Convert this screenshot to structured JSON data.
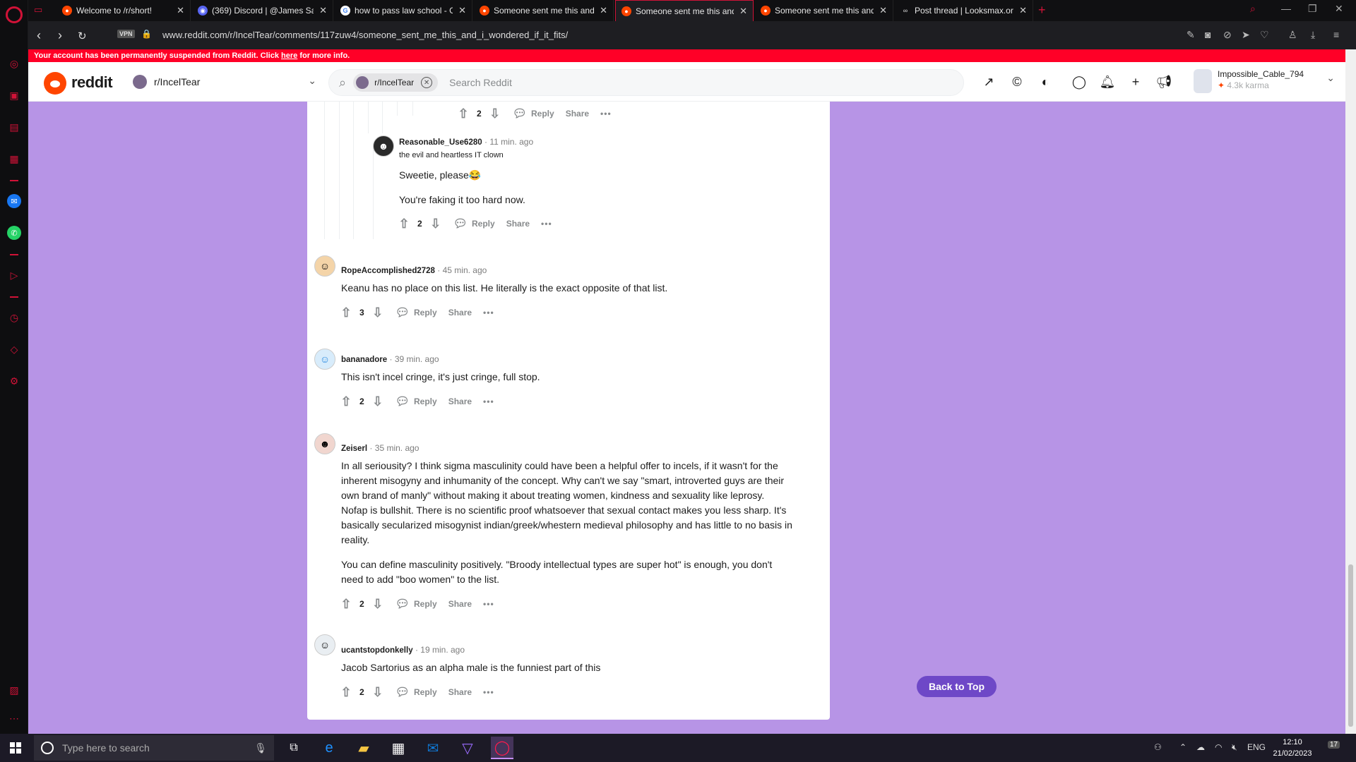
{
  "browser": {
    "tabs": [
      {
        "title": "Welcome to /r/short!",
        "icon": "reddit"
      },
      {
        "title": "(369) Discord | @James Sa",
        "icon": "discord",
        "badge": "369"
      },
      {
        "title": "how to pass law school - G",
        "icon": "google"
      },
      {
        "title": "Someone sent me this and",
        "icon": "reddit"
      },
      {
        "title": "Someone sent me this and",
        "icon": "reddit",
        "active": true
      },
      {
        "title": "Someone sent me this and",
        "icon": "reddit"
      },
      {
        "title": "Post thread | Looksmax.org",
        "icon": "looksmax"
      }
    ],
    "url": "www.reddit.com/r/IncelTear/comments/117zuw4/someone_sent_me_this_and_i_wondered_if_it_fits/",
    "vpn_label": "VPN"
  },
  "banner": {
    "text_before": "Your account has been permanently suspended from Reddit. Click ",
    "link": "here",
    "text_after": " for more info."
  },
  "header": {
    "logo_text": "reddit",
    "subreddit": "r/IncelTear",
    "search_chip": "r/IncelTear",
    "search_placeholder": "Search Reddit",
    "username": "Impossible_Cable_794",
    "karma": "4.3k karma"
  },
  "comments": [
    {
      "id": "top-partial",
      "score": "2",
      "reply": "Reply",
      "share": "Share"
    },
    {
      "id": "c1",
      "username": "Reasonable_Use6280",
      "time": "11 min. ago",
      "flair": "the evil and heartless IT clown",
      "paragraphs": [
        "Sweetie, please😂",
        "You're faking it too hard now."
      ],
      "score": "2",
      "reply": "Reply",
      "share": "Share"
    },
    {
      "id": "c2",
      "username": "RopeAccomplished2728",
      "time": "45 min. ago",
      "paragraphs": [
        "Keanu has no place on this list. He literally is the exact opposite of that list."
      ],
      "score": "3",
      "reply": "Reply",
      "share": "Share"
    },
    {
      "id": "c3",
      "username": "bananadore",
      "time": "39 min. ago",
      "paragraphs": [
        "This isn't incel cringe, it's just cringe, full stop."
      ],
      "score": "2",
      "reply": "Reply",
      "share": "Share"
    },
    {
      "id": "c4",
      "username": "Zeiserl",
      "time": "35 min. ago",
      "paragraphs": [
        "In all seriousity? I think sigma masculinity could have been a helpful offer to incels, if it wasn't for the inherent misogyny and inhumanity of the concept. Why can't we say \"smart, introverted guys are their own brand of manly\" without making it about treating women, kindness and sexuality like leprosy. Nofap is bullshit. There is no scientific proof whatsoever that sexual contact makes you less sharp. It's basically secularized misogynist indian/greek/whestern medieval philosophy and has little to no basis in reality.",
        "You can define masculinity positively. \"Broody intellectual types are super hot\" is enough, you don't need to add \"boo women\" to the list."
      ],
      "score": "2",
      "reply": "Reply",
      "share": "Share"
    },
    {
      "id": "c5",
      "username": "ucantstopdonkelly",
      "time": "19 min. ago",
      "paragraphs": [
        "Jacob Sartorius as an alpha male is the funniest part of this"
      ],
      "score": "2",
      "reply": "Reply",
      "share": "Share"
    }
  ],
  "back_to_top": "Back to Top",
  "taskbar": {
    "search_placeholder": "Type here to search",
    "lang": "ENG",
    "time": "12:10",
    "date": "21/02/2023",
    "notifications": "17"
  },
  "colors": {
    "page_bg": "#b794e6",
    "banner": "#ff0027",
    "reddit_orange": "#ff4500",
    "back_to_top": "#6e48c7",
    "opera_red": "#d01237"
  }
}
